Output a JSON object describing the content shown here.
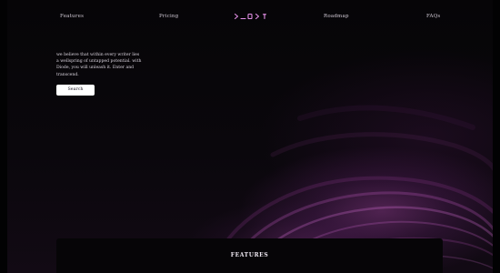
{
  "nav": {
    "features": "Features",
    "pricing": "Pricing",
    "roadmap": "Roadmap",
    "faqs": "FAQs",
    "logo_icon": "brand-logo-icon"
  },
  "hero": {
    "description": "we believe that within every writer lies a wellspring of untapped potential. with Diode, you will unleash it. Enter and transcend.",
    "search_label": "Search"
  },
  "features": {
    "title": "FEATURES"
  },
  "colors": {
    "background": "#050406",
    "accent": "#a846a8",
    "logo": "#e28fe6",
    "button_bg": "#ffffff"
  }
}
